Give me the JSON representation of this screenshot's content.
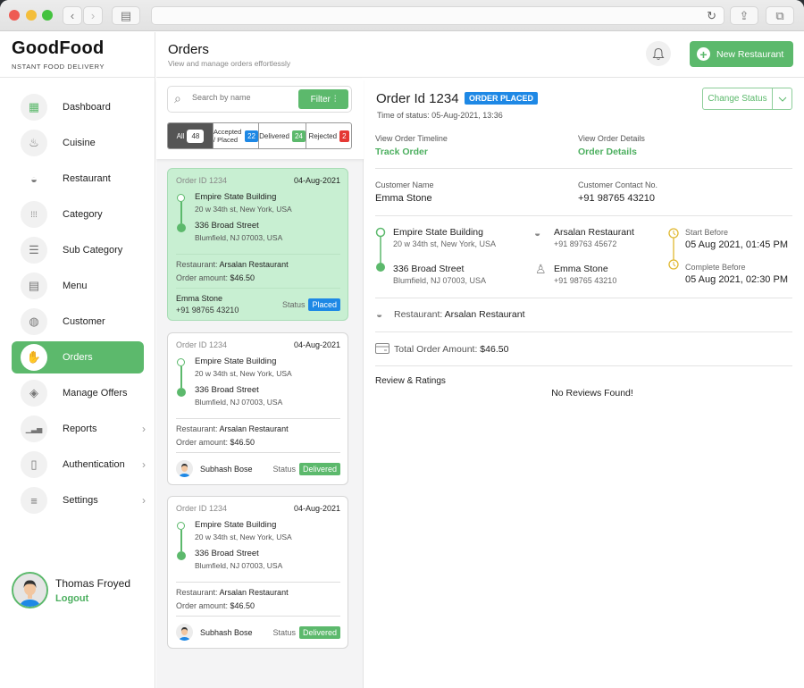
{
  "browser": {
    "back_icon": "‹",
    "forward_icon": "›",
    "sidebar_icon": "▤",
    "reload_icon": "↻",
    "share_icon": "⇪",
    "tabs_icon": "⧉"
  },
  "brand": {
    "name": "GoodFood",
    "tagline": "NSTANT FOOD DELIVERY"
  },
  "sidebar": {
    "items": [
      {
        "label": "Dashboard",
        "icon": "▦"
      },
      {
        "label": "Cuisine",
        "icon": "♨"
      },
      {
        "label": "Restaurant",
        "icon": "◒"
      },
      {
        "label": "Category",
        "icon": "⁞⁞⁞"
      },
      {
        "label": "Sub Category",
        "icon": "☰"
      },
      {
        "label": "Menu",
        "icon": "▤"
      },
      {
        "label": "Customer",
        "icon": "◍"
      },
      {
        "label": "Orders",
        "icon": "✋"
      },
      {
        "label": "Manage Offers",
        "icon": "◈"
      },
      {
        "label": "Reports",
        "icon": "▁▃▅"
      },
      {
        "label": "Authentication",
        "icon": "▯"
      },
      {
        "label": "Settings",
        "icon": "≡"
      }
    ],
    "chevron": "›",
    "active_index": 7
  },
  "user": {
    "name": "Thomas Froyed",
    "logout_label": "Logout"
  },
  "header": {
    "title": "Orders",
    "subtitle": "View and manage orders effortlessly",
    "bell_icon": "🔔",
    "new_button_label": "New Restaurant",
    "new_button_icon": "+"
  },
  "list": {
    "search_placeholder": "Search by name",
    "search_icon": "⌕",
    "filter_label": "Filter",
    "filter_icon": "⫶",
    "tabs": [
      {
        "label": "All",
        "count": "48",
        "color": "#ffffff"
      },
      {
        "label": "Accepted / Placed",
        "count": "22",
        "color": "#1e88e5"
      },
      {
        "label": "Delivered",
        "count": "24",
        "color": "#5cb96c"
      },
      {
        "label": "Rejected",
        "count": "2",
        "color": "#e53935"
      }
    ],
    "restaurant_prefix": "Restaurant: ",
    "amount_prefix": "Order amount: ",
    "status_label": "Status",
    "orders": [
      {
        "id": "Order ID 1234",
        "date": "04-Aug-2021",
        "pickup_name": "Empire State Building",
        "pickup_addr": "20 w 34th st, New York, USA",
        "drop_name": "336 Broad Street",
        "drop_addr": "Blumfield, NJ 07003, USA",
        "restaurant": "Arsalan Restaurant",
        "amount": "$46.50",
        "customer": "Emma Stone",
        "phone": "+91 98765 43210",
        "status": "Placed",
        "status_color": "#1e88e5",
        "selected": true
      },
      {
        "id": "Order ID 1234",
        "date": "04-Aug-2021",
        "pickup_name": "Empire State Building",
        "pickup_addr": "20 w 34th st, New York, USA",
        "drop_name": "336 Broad Street",
        "drop_addr": "Blumfield, NJ 07003, USA",
        "restaurant": "Arsalan Restaurant",
        "amount": "$46.50",
        "customer": "Subhash Bose",
        "status": "Delivered",
        "status_color": "#5cb96c",
        "selected": false
      },
      {
        "id": "Order ID 1234",
        "date": "04-Aug-2021",
        "pickup_name": "Empire State Building",
        "pickup_addr": "20 w 34th st, New York, USA",
        "drop_name": "336 Broad Street",
        "drop_addr": "Blumfield, NJ 07003, USA",
        "restaurant": "Arsalan Restaurant",
        "amount": "$46.50",
        "customer": "Subhash Bose",
        "status": "Delivered",
        "status_color": "#5cb96c",
        "selected": false
      }
    ]
  },
  "detail": {
    "title": "Order Id 1234",
    "badge": "ORDER PLACED",
    "status_time": "Time of status: 05-Aug-2021, 13:36",
    "change_status_label": "Change Status",
    "caret_icon": "⌄",
    "timeline_label": "View Order Timeline",
    "timeline_link": "Track Order",
    "details_label": "View Order Details",
    "details_link": "Order Details",
    "customer_name_label": "Customer Name",
    "customer_name": "Emma Stone",
    "customer_contact_label": "Customer Contact No.",
    "customer_contact": "+91 98765 43210",
    "pickup_name": "Empire State Building",
    "pickup_addr": "20 w 34th st, New York, USA",
    "drop_name": "336 Broad Street",
    "drop_addr": "Blumfield, NJ 07003, USA",
    "restaurant_name": "Arsalan Restaurant",
    "restaurant_phone": "+91 89763 45672",
    "customer_person": "Emma Stone",
    "customer_phone": "+91 98765 43210",
    "start_label": "Start Before",
    "start_value": "05 Aug 2021, 01:45 PM",
    "complete_label": "Complete Before",
    "complete_value": "05 Aug 2021, 02:30 PM",
    "restaurant_row_label": "Restaurant: ",
    "restaurant_row_value": "Arsalan Restaurant",
    "total_label": "Total Order Amount: ",
    "total_value": "$46.50",
    "reviews_title": "Review & Ratings",
    "no_reviews": "No Reviews Found!",
    "icons": {
      "restaurant": "◒",
      "person": "♙",
      "clock": "◷",
      "card": "▭"
    }
  },
  "colors": {
    "accent": "#5cb96c",
    "placed": "#1e88e5",
    "rejected": "#e53935",
    "schedule": "#e0b830"
  }
}
